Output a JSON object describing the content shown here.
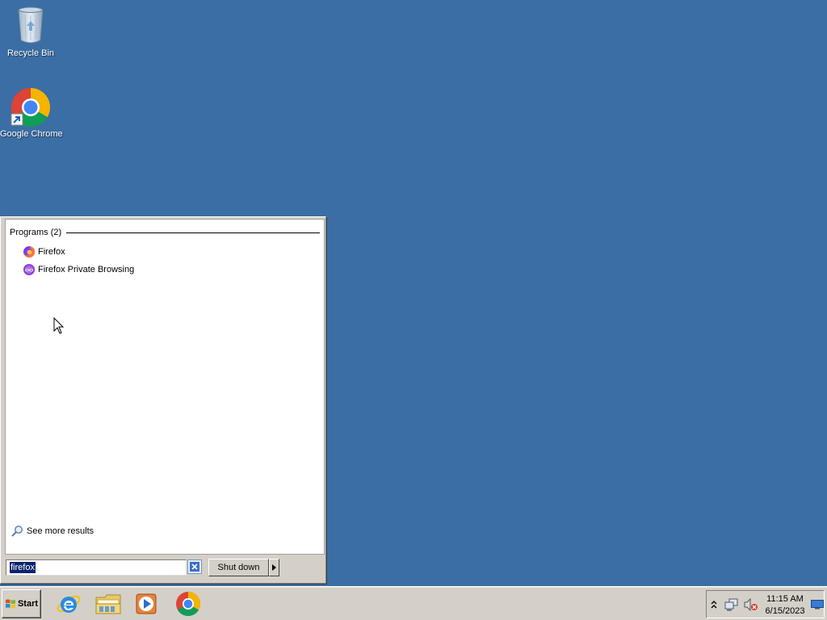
{
  "desktop": {
    "icons": [
      {
        "label": "Recycle Bin",
        "icon": "recycle-bin-icon"
      },
      {
        "label": "Google Chrome",
        "icon": "chrome-icon"
      }
    ]
  },
  "start_menu": {
    "section_header": "Programs (2)",
    "results": [
      {
        "label": "Firefox",
        "icon": "firefox-icon"
      },
      {
        "label": "Firefox Private Browsing",
        "icon": "firefox-private-icon"
      }
    ],
    "see_more": "See more results",
    "search_value": "firefox",
    "shutdown_label": "Shut down"
  },
  "taskbar": {
    "start_label": "Start",
    "pinned": [
      "internet-explorer-icon",
      "file-explorer-icon",
      "media-player-icon",
      "chrome-icon"
    ],
    "clock": {
      "time": "11:15 AM",
      "date": "6/15/2023"
    }
  },
  "colors": {
    "desktop_background": "#3a6ea5",
    "taskbar": "#d4d0c8",
    "selection": "#0a246a"
  }
}
